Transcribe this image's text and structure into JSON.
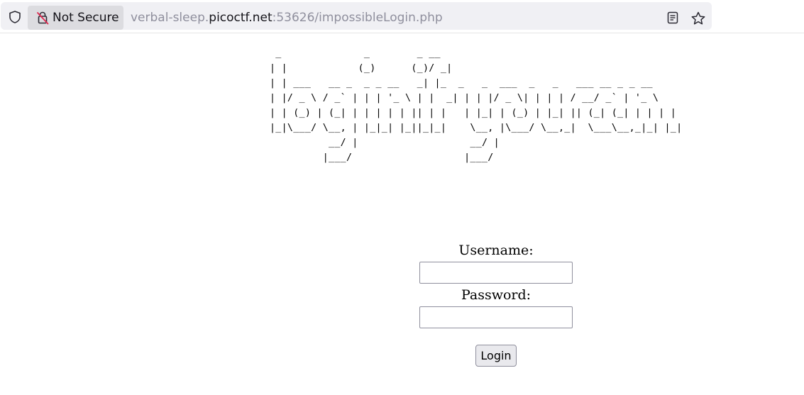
{
  "browser": {
    "security_label": "Not Secure",
    "url_prefix": "verbal-sleep.",
    "url_host": "picoctf.net",
    "url_suffix": ":53626/impossibleLogin.php",
    "icons": [
      "shield-icon",
      "lock-slash-icon",
      "reader-view-icon",
      "bookmark-star-icon"
    ]
  },
  "page": {
    "ascii_banner": " _              _        _ __\n| |            (_)      (_)/ _|\n| | ___   __ _  _ _ __   _| |_  _   _  ___  _   _   ___ __ _ _ __\n| |/ _ \\ / _` | | | '_ \\ | |  _| | | |/ _ \\| | | | / __/ _` | '_ \\\n| | (_) | (_| | | | | | || | |   | |_| | (_) | |_| || (_| (_| | | | |\n|_|\\___/ \\__, | |_|_| |_||_|_|    \\__, |\\___/ \\__,_|  \\___\\__,_|_| |_|\n          __/ |                   __/ |\n         |___/                   |___/",
    "username_label": "Username:",
    "password_label": "Password:",
    "username_value": "",
    "password_value": "",
    "login_label": "Login"
  },
  "colors": {
    "urlbar_bg": "#f0f0f4",
    "secure_pill_bg": "#dcdce0",
    "url_dim": "#8f8f9d",
    "url_host": "#15141a",
    "button_bg": "#e9e9ed"
  }
}
